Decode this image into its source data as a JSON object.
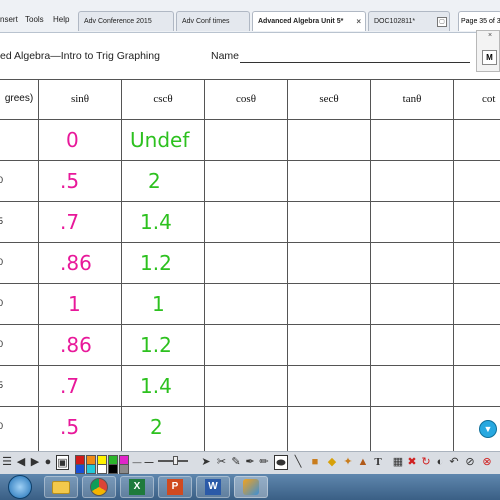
{
  "menu": [
    {
      "label": "nsert"
    },
    {
      "label": "Tools"
    },
    {
      "label": "Help"
    }
  ],
  "tabs": [
    {
      "label": "Adv Conference 2015",
      "active": false
    },
    {
      "label": "Adv Conf times",
      "active": false
    },
    {
      "label": "Advanced Algebra Unit 5*",
      "active": true
    },
    {
      "label": "DOC102811*",
      "active": false
    }
  ],
  "page_indicator": "Page 35 of 3",
  "worksheet": {
    "title": "ed Algebra—Intro to Trig Graphing",
    "name_label": "Name",
    "first_col_header": "grees)",
    "columns": [
      "sinθ",
      "cscθ",
      "cosθ",
      "secθ",
      "tanθ",
      "cot"
    ],
    "row_labels": [
      "",
      "0",
      "5",
      "0",
      "0",
      "0",
      "5",
      "0"
    ],
    "sin_values": [
      "0",
      ".5",
      ".7",
      ".86",
      "1",
      ".86",
      ".7",
      ".5"
    ],
    "csc_values": [
      "Undef",
      "2",
      "1.4",
      "1.2",
      "1",
      "1.2",
      "1.4",
      "2"
    ]
  },
  "colors": {
    "sin_ink": "#e8189a",
    "csc_ink": "#2dc11f",
    "grid": "#555555"
  },
  "side_panel": {
    "close": "×",
    "letter": "M"
  },
  "toolbar_colors": [
    "#d01b1b",
    "#f08a17",
    "#fff200",
    "#2bb52b",
    "#e025c9",
    "#1a4fd6",
    "#22c9d8",
    "#ffffff",
    "#000000",
    "#8a8a8a"
  ],
  "taskbar": [
    {
      "icon": "file-explorer-icon"
    },
    {
      "icon": "chrome-icon"
    },
    {
      "icon": "excel-icon"
    },
    {
      "icon": "powerpoint-icon"
    },
    {
      "icon": "word-icon"
    },
    {
      "icon": "notebook-icon"
    }
  ]
}
